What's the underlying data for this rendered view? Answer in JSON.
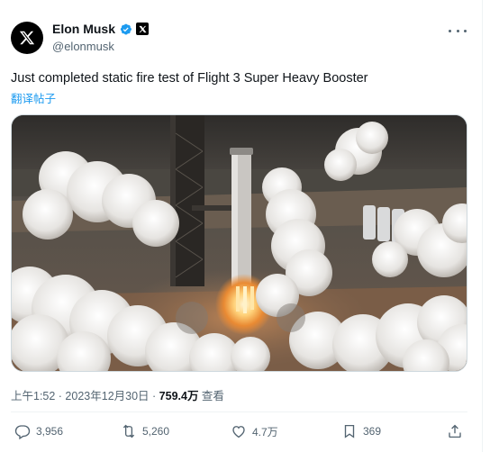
{
  "author": {
    "display_name": "Elon Musk",
    "handle": "@elonmusk",
    "verified": true,
    "avatar_icon": "x-logo-icon",
    "affiliation_icon": "x-logo-icon"
  },
  "tweet": {
    "text": "Just completed static fire test of Flight 3 Super Heavy Booster",
    "translate_label": "翻译帖子"
  },
  "meta": {
    "timestamp": "上午1:52 · 2023年12月30日 · ",
    "views_count": "759.4万",
    "views_label": " 查看"
  },
  "actions": {
    "reply_count": "3,956",
    "repost_count": "5,260",
    "like_count": "4.7万",
    "bookmark_count": "369"
  },
  "colors": {
    "accent": "#1d9bf0",
    "text_primary": "#0f1419",
    "text_secondary": "#536471",
    "divider": "#eff3f4"
  }
}
